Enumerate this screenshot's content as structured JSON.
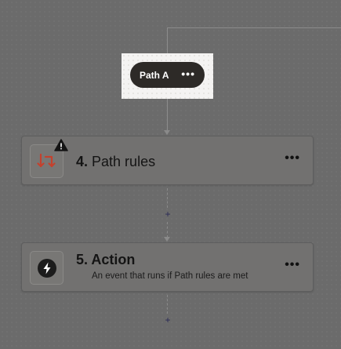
{
  "branch": {
    "label": "Path A",
    "menu_icon": "more-horizontal-icon"
  },
  "steps": [
    {
      "number": "4.",
      "title": "Path rules",
      "icon": "path-rules-icon",
      "warning_icon": "warning-icon",
      "menu_icon": "more-horizontal-icon"
    },
    {
      "number": "5.",
      "title": "Action",
      "subtitle": "An event that runs if Path rules are met",
      "icon": "lightning-bolt-icon",
      "menu_icon": "more-horizontal-icon"
    }
  ],
  "add_step": {
    "label": "+"
  },
  "colors": {
    "path_rules_icon": "#c4412d",
    "pill_background": "#2d2a27",
    "canvas": "#6b6b6b"
  }
}
